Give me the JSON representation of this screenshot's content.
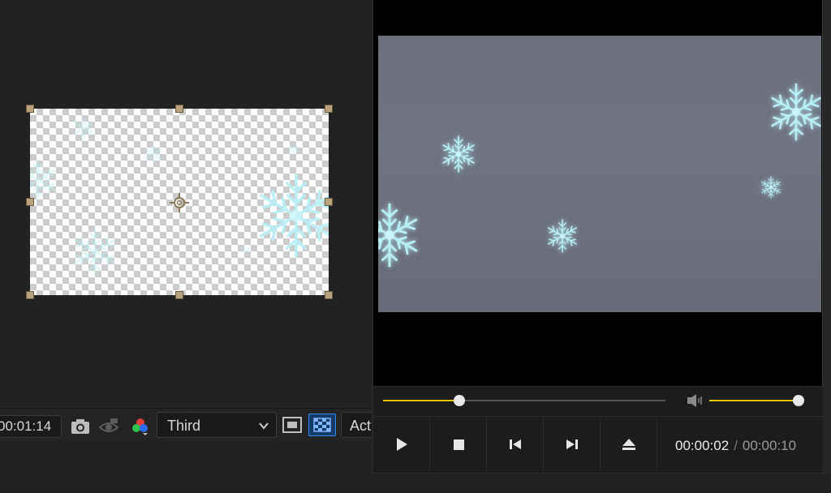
{
  "composition": {
    "toolbar": {
      "timecode": "00:01:14",
      "view_dropdown": {
        "selected": "Third"
      },
      "active_camera_label": "Active Camera"
    }
  },
  "player": {
    "seek_position": 0.27,
    "volume_level": 0.98,
    "time_current": "00:00:02",
    "time_separator": "/",
    "time_total": "00:00:10",
    "buttons": [
      {
        "name": "play",
        "icon": "play-icon"
      },
      {
        "name": "stop",
        "icon": "stop-icon"
      },
      {
        "name": "previous",
        "icon": "skip-back-icon"
      },
      {
        "name": "next",
        "icon": "skip-forward-icon"
      },
      {
        "name": "eject",
        "icon": "eject-icon"
      }
    ]
  },
  "colors": {
    "accent_yellow": "#e5c400",
    "selection_blue": "#2d8cff",
    "handle_tan": "#b9a27c",
    "snowflake": "#9fe3ee"
  }
}
